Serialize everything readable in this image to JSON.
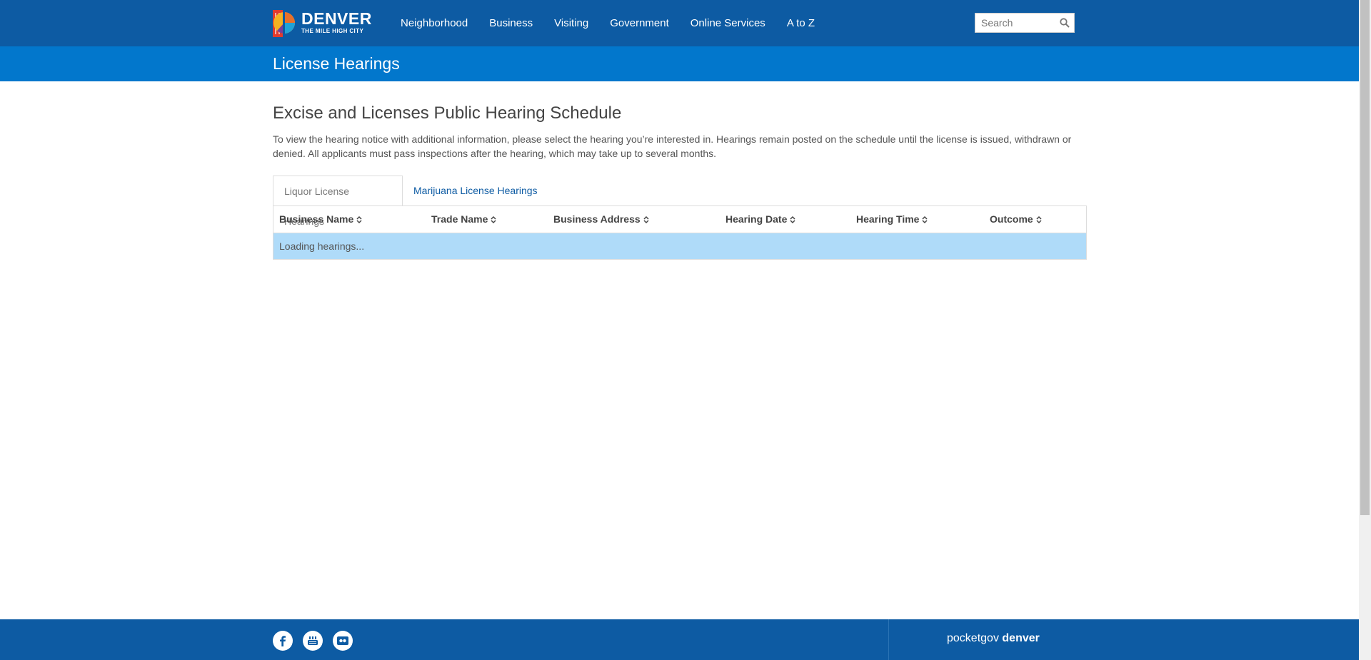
{
  "header": {
    "logo": {
      "title": "DENVER",
      "tagline": "THE MILE HIGH CITY"
    },
    "nav": [
      "Neighborhood",
      "Business",
      "Visiting",
      "Government",
      "Online Services",
      "A to Z"
    ],
    "search_placeholder": "Search"
  },
  "page_title": "License Hearings",
  "main": {
    "heading": "Excise and Licenses Public Hearing Schedule",
    "description": "To view the hearing notice with additional information, please select the hearing you’re interested in. Hearings remain posted on the schedule until the license is issued, withdrawn or denied. All applicants must pass inspections after the hearing, which may take up to several months.",
    "tabs": [
      {
        "label": "Liquor License Hearings",
        "active": true
      },
      {
        "label": "Marijuana License Hearings",
        "active": false
      }
    ],
    "table": {
      "columns": [
        "Business Name",
        "Trade Name",
        "Business Address",
        "Hearing Date",
        "Hearing Time",
        "Outcome"
      ],
      "loading_text": "Loading hearings..."
    }
  },
  "footer": {
    "social": [
      "facebook-icon",
      "youtube-icon",
      "flickr-icon"
    ],
    "app_prefix": "pocketgov",
    "app_name": "denver"
  },
  "colors": {
    "nav_blue": "#0d5ba3",
    "title_blue": "#0277cc",
    "loading_row": "#afdbf9"
  }
}
